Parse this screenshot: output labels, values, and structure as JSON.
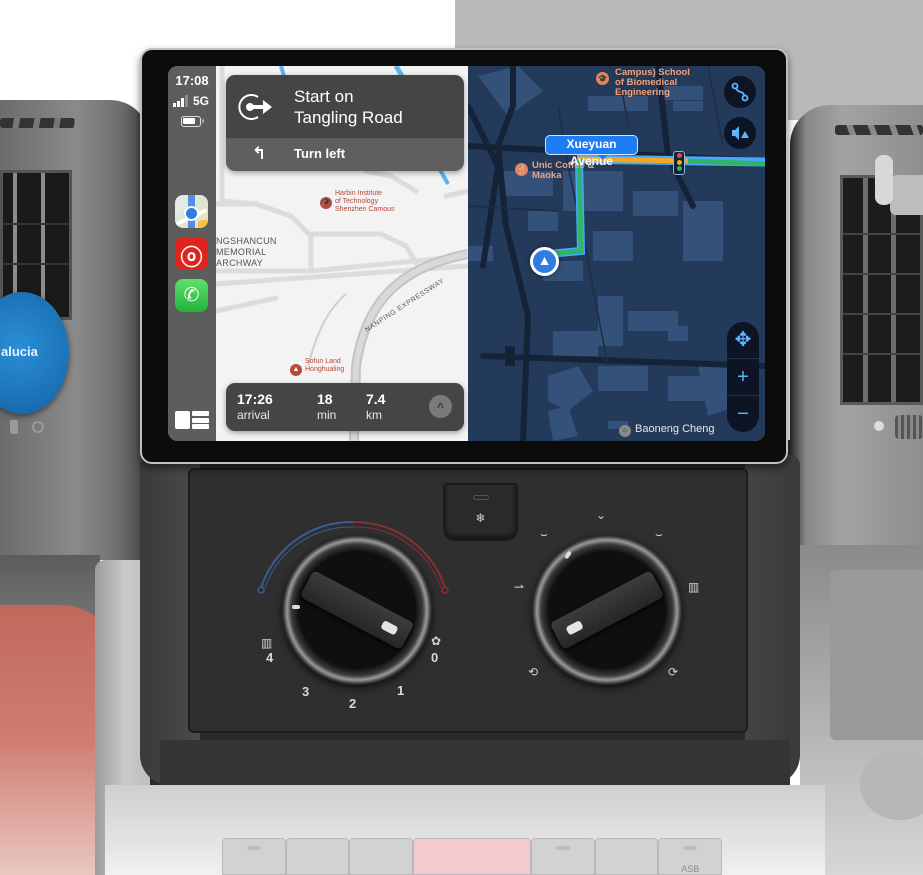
{
  "status_bar": {
    "time": "17:08",
    "network": "5G",
    "signal_bars": 3,
    "signal_bars_total": 4
  },
  "sidebar": {
    "apps": [
      {
        "name": "Maps",
        "icon": "maps-app-icon"
      },
      {
        "name": "NetEase Cloud Music",
        "icon": "music-app-icon",
        "glyph": "ⓞ"
      },
      {
        "name": "Phone",
        "icon": "phone-app-icon",
        "glyph": "✆"
      }
    ],
    "dashboard_icon": "dashboard-toggle-icon"
  },
  "navigation": {
    "primary_instruction": "Start on",
    "primary_street": "Tangling Road",
    "next_instruction": "Turn left",
    "next_icon_glyph": "↰",
    "eta": {
      "arrival_time": "17:26",
      "arrival_label": "arrival",
      "duration": "18",
      "duration_unit": "min",
      "distance": "7.4",
      "distance_unit": "km",
      "expand_glyph": "^"
    }
  },
  "light_map": {
    "pois": [
      {
        "label_line1": "Harbin Institute",
        "label_line2": "of Technology",
        "label_line3": "Shenzhen Camous"
      },
      {
        "label_line1": "Sofun Land",
        "label_line2": "Honghualing"
      }
    ],
    "area_label": [
      "NGSHANCUN",
      "MEMORIAL",
      "ARCHWAY"
    ],
    "road_label": "NANPING EXPRESSWAY"
  },
  "dark_map": {
    "pois": [
      {
        "label_line1": "Campus) School",
        "label_line2": "of Biomedical",
        "label_line3": "Engineering"
      },
      {
        "label_line1": "Unic Coffee &",
        "label_line2": "Maoka"
      }
    ],
    "street_callout": "Xueyuan Avenue",
    "bottom_place": "Baoneng Cheng",
    "route_colors": {
      "congested": "#f5a623",
      "clear": "#2fb56a",
      "outline": "#4aa7ff"
    },
    "traffic_light_colors": [
      "#e24a3b",
      "#f5a623",
      "#2fb56a"
    ],
    "buttons": {
      "route_overview_glyph": "⟟",
      "audio_glyph": "🔈",
      "pan_glyph": "✥",
      "zoom_in_glyph": "+",
      "zoom_out_glyph": "−"
    }
  },
  "hvac": {
    "ac_glyph": "❄",
    "fan_labels": [
      "0",
      "1",
      "2",
      "3",
      "4"
    ],
    "fan_icon_glyph": "✿",
    "defrost_glyph": "▥"
  },
  "dashboard": {
    "air_freshener_brand": "alucia",
    "switch_labels": [
      "",
      "",
      "",
      "",
      "",
      "",
      "ASB"
    ]
  }
}
